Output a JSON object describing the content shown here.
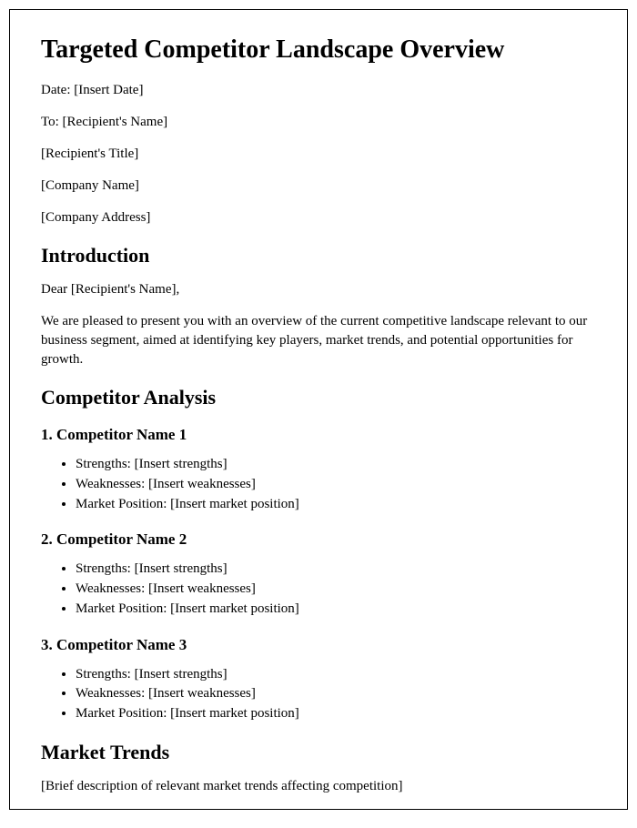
{
  "title": "Targeted Competitor Landscape Overview",
  "meta": {
    "date": "Date: [Insert Date]",
    "to": "To: [Recipient's Name]",
    "recipient_title": "[Recipient's Title]",
    "company_name": "[Company Name]",
    "company_address": "[Company Address]"
  },
  "introduction": {
    "heading": "Introduction",
    "salutation": "Dear [Recipient's Name],",
    "body": "We are pleased to present you with an overview of the current competitive landscape relevant to our business segment, aimed at identifying key players, market trends, and potential opportunities for growth."
  },
  "competitor_analysis": {
    "heading": "Competitor Analysis",
    "competitors": [
      {
        "heading": "1. Competitor Name 1",
        "strengths": "Strengths: [Insert strengths]",
        "weaknesses": "Weaknesses: [Insert weaknesses]",
        "market_position": "Market Position: [Insert market position]"
      },
      {
        "heading": "2. Competitor Name 2",
        "strengths": "Strengths: [Insert strengths]",
        "weaknesses": "Weaknesses: [Insert weaknesses]",
        "market_position": "Market Position: [Insert market position]"
      },
      {
        "heading": "3. Competitor Name 3",
        "strengths": "Strengths: [Insert strengths]",
        "weaknesses": "Weaknesses: [Insert weaknesses]",
        "market_position": "Market Position: [Insert market position]"
      }
    ]
  },
  "market_trends": {
    "heading": "Market Trends",
    "body": "[Brief description of relevant market trends affecting competition]"
  }
}
